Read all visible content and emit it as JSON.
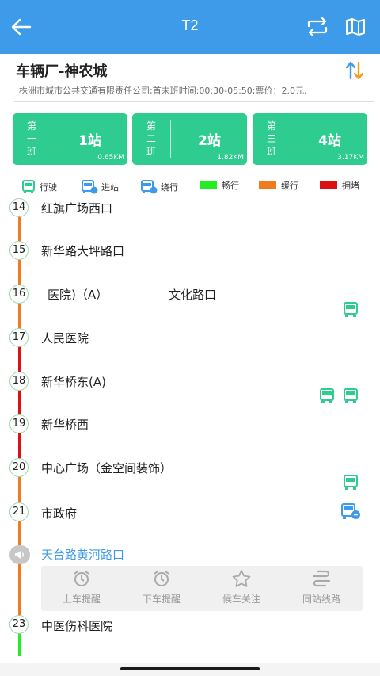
{
  "header": {
    "title": "T2",
    "back_icon": "arrow-left-icon",
    "switch_icon": "refresh-direction-icon",
    "map_icon": "map-icon"
  },
  "route": {
    "name": "车辆厂-神农城",
    "info": "株洲市城市公共交通有限责任公司;首末班时间:00:30-05:50;票价：2.0元."
  },
  "shifts": [
    {
      "label": [
        "第",
        "一",
        "班"
      ],
      "stations": "1站",
      "distance": "0.65KM"
    },
    {
      "label": [
        "第",
        "二",
        "班"
      ],
      "stations": "2站",
      "distance": "1.82KM"
    },
    {
      "label": [
        "第",
        "三",
        "班"
      ],
      "stations": "4站",
      "distance": "3.17KM"
    }
  ],
  "legend": {
    "running": "行驶",
    "arriving": "进站",
    "detour": "绕行",
    "smooth": "畅行",
    "slow": "缓行",
    "jam": "拥堵"
  },
  "colors": {
    "brand": "#3d9be9",
    "shift_bg": "#2ecc8e",
    "smooth": "#22ee22",
    "slow": "#f07b1e",
    "jam": "#dd1111",
    "bus_green": "#2ecc8e",
    "bus_blue": "#3d9be9"
  },
  "stops": [
    {
      "num": "14",
      "name": "红旗广场西口"
    },
    {
      "num": "15",
      "name": "新华路大坪路口"
    },
    {
      "num": "16",
      "name": "医院)（A）",
      "name2": "文化路口"
    },
    {
      "num": "17",
      "name": "人民医院"
    },
    {
      "num": "18",
      "name": "新华桥东(A)"
    },
    {
      "num": "19",
      "name": "新华桥西"
    },
    {
      "num": "20",
      "name": "中心广场（金空间装饰）"
    },
    {
      "num": "21",
      "name": "市政府"
    },
    {
      "num": "",
      "name": "天台路黄河路口"
    },
    {
      "num": "23",
      "name": "中医伤科医院"
    }
  ],
  "actions": [
    {
      "label": "上车提醒",
      "icon": "alarm-clock-icon"
    },
    {
      "label": "下车提醒",
      "icon": "alarm-clock-icon"
    },
    {
      "label": "候车关注",
      "icon": "star-icon"
    },
    {
      "label": "同站线路",
      "icon": "route-transfer-icon"
    }
  ]
}
